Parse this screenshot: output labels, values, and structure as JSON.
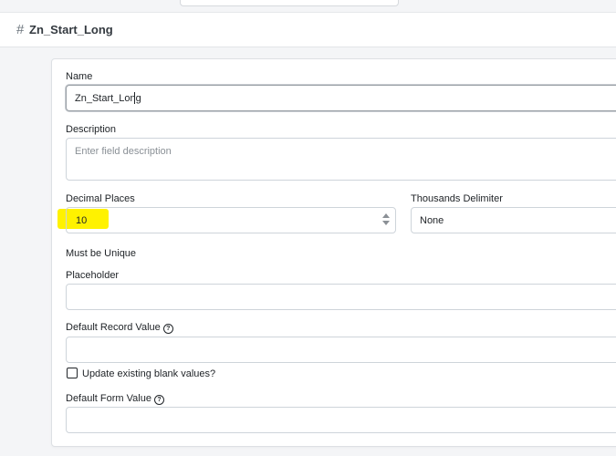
{
  "header": {
    "hash_symbol": "#",
    "title": "Zn_Start_Long"
  },
  "form": {
    "name": {
      "label": "Name",
      "value": "Zn_Start_Long"
    },
    "description": {
      "label": "Description",
      "placeholder": "Enter field description",
      "value": ""
    },
    "decimal_places": {
      "label": "Decimal Places",
      "value": "10"
    },
    "thousands_delimiter": {
      "label": "Thousands Delimiter",
      "selected": "None"
    },
    "must_be_unique": {
      "label": "Must be Unique"
    },
    "placeholder": {
      "label": "Placeholder",
      "value": ""
    },
    "default_record_value": {
      "label": "Default Record Value",
      "help_icon": "?",
      "value": ""
    },
    "update_blank": {
      "label": "Update existing blank values?",
      "checked": false
    },
    "default_form_value": {
      "label": "Default Form Value",
      "help_icon": "?",
      "value": ""
    }
  },
  "colors": {
    "highlight": "#fff200",
    "border": "#ced4da",
    "page_bg": "#f4f5f7"
  }
}
